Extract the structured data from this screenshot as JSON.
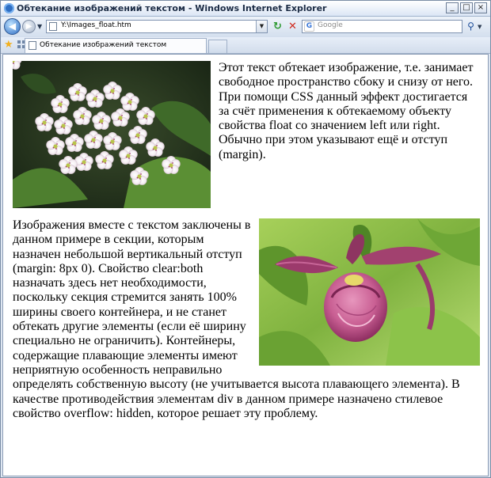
{
  "window": {
    "title": "Обтекание изображений текстом - Windows Internet Explorer",
    "controls": {
      "minimize": "_",
      "maximize": "□",
      "close": "×"
    }
  },
  "navbar": {
    "address": "Y:\\Images_float.htm",
    "search_placeholder": "Google",
    "search_provider_letter": "G"
  },
  "tabs": [
    {
      "label": "Обтекание изображений текстом"
    }
  ],
  "page": {
    "paragraph1": "Этот текст обтекает изображение, т.е. занимает свободное пространство сбоку и снизу от него. При помощи CSS данный эффект достигается за счёт применения к обтекаемому объекту свойства float со значением left или right. Обычно при этом указывают ещё и отступ (margin).",
    "paragraph2": "Изображения вместе с текстом заключены в данном примере в секции, которым назначен небольшой вертикальный отступ (margin: 8px 0). Свойство clear:both назначать здесь нет необходимости, поскольку секция стремится занять 100% ширины своего контейнера, и не станет обтекать другие элементы (если её ширину специально не ограничить). Контейнеры, содержащие плавающие элементы имеют неприятную особенность неправильно определять собственную высоту (не учитывается высота плавающего элемента). В качестве противодействия элементам div в данном примере назначено стилевое свойство overflow: hidden, которое решает эту проблему."
  },
  "colors": {
    "chrome": "#dfe7f2",
    "accent": "#2d6cc2",
    "page_background": "#ffffff"
  }
}
